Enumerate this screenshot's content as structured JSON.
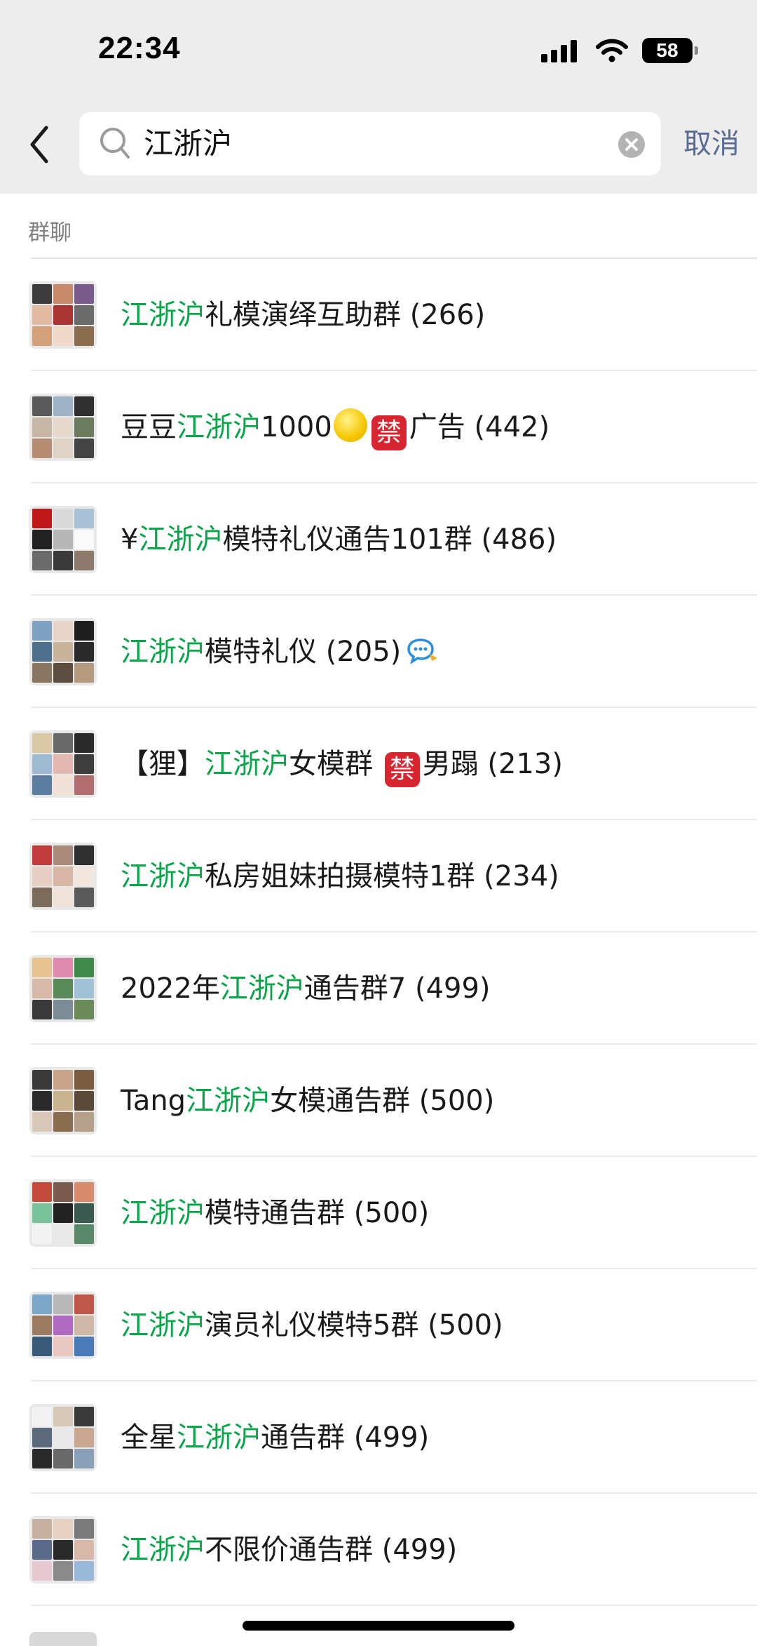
{
  "status_bar": {
    "time": "22:34",
    "battery": "58"
  },
  "search": {
    "query": "江浙沪",
    "cancel_label": "取消"
  },
  "section": {
    "label": "群聊"
  },
  "results": [
    {
      "parts": [
        {
          "t": "江浙沪",
          "hl": true
        },
        {
          "t": "礼模演绎互助群 (266)"
        }
      ]
    },
    {
      "parts": [
        {
          "t": "豆豆"
        },
        {
          "t": "江浙沪",
          "hl": true
        },
        {
          "t": "1000"
        },
        {
          "e": "sun-emoji"
        },
        {
          "e": "prohibited-emoji"
        },
        {
          "t": "广告 (442)"
        }
      ]
    },
    {
      "parts": [
        {
          "t": "¥"
        },
        {
          "t": "江浙沪",
          "hl": true
        },
        {
          "t": "模特礼仪通告101群 (486)"
        }
      ]
    },
    {
      "parts": [
        {
          "t": "江浙沪",
          "hl": true
        },
        {
          "t": "模特礼仪 (205)"
        },
        {
          "e": "chat-bubble-icon"
        }
      ]
    },
    {
      "parts": [
        {
          "t": "【狸】"
        },
        {
          "t": "江浙沪",
          "hl": true
        },
        {
          "t": "女模群 "
        },
        {
          "e": "prohibited-emoji"
        },
        {
          "t": "男蹋 (213)"
        }
      ]
    },
    {
      "parts": [
        {
          "t": "江浙沪",
          "hl": true
        },
        {
          "t": "私房姐妹拍摄模特1群 (234)"
        }
      ]
    },
    {
      "parts": [
        {
          "t": "2022年"
        },
        {
          "t": "江浙沪",
          "hl": true
        },
        {
          "t": "通告群7 (499)"
        }
      ]
    },
    {
      "parts": [
        {
          "t": "Tang"
        },
        {
          "t": "江浙沪",
          "hl": true
        },
        {
          "t": "女模通告群 (500)"
        }
      ]
    },
    {
      "parts": [
        {
          "t": "江浙沪",
          "hl": true
        },
        {
          "t": "模特通告群 (500)"
        }
      ]
    },
    {
      "parts": [
        {
          "t": "江浙沪",
          "hl": true
        },
        {
          "t": "演员礼仪模特5群 (500)"
        }
      ]
    },
    {
      "parts": [
        {
          "t": "全星"
        },
        {
          "t": "江浙沪",
          "hl": true
        },
        {
          "t": "通告群 (499)"
        }
      ]
    },
    {
      "parts": [
        {
          "t": "江浙沪",
          "hl": true
        },
        {
          "t": "不限价通告群 (499)"
        }
      ]
    }
  ],
  "emoji_text": {
    "prohibited": "禁"
  },
  "colors": {
    "highlight": "#07a648",
    "link": "#576b95",
    "topbar": "#ededed"
  }
}
